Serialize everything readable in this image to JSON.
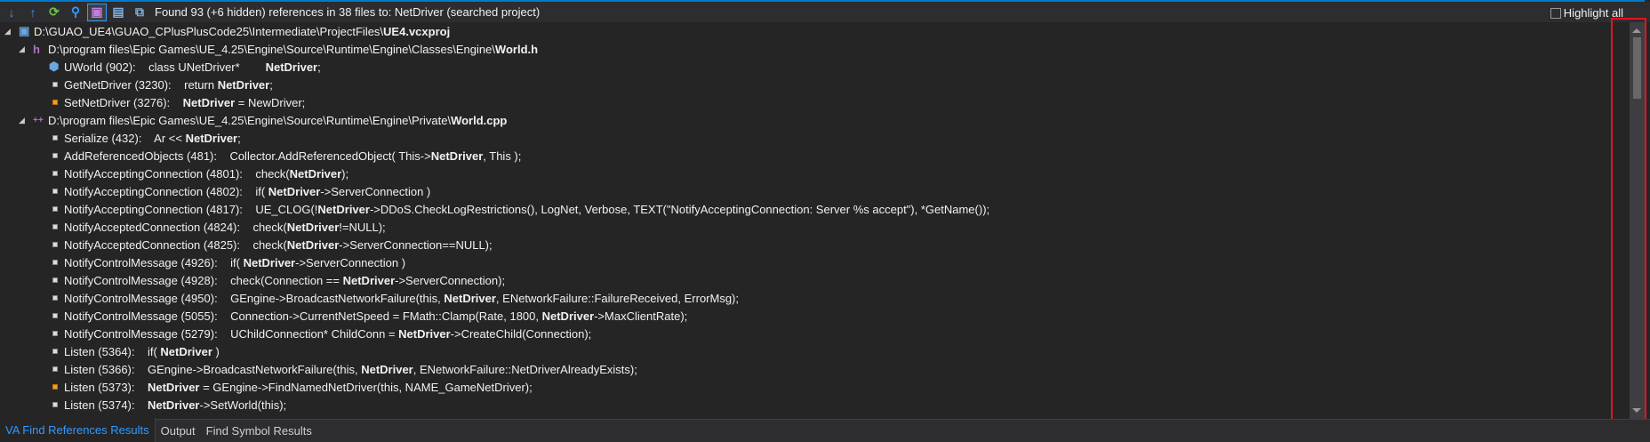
{
  "toolbar": {
    "buttons": [
      {
        "name": "next-result-icon",
        "glyph": "↓",
        "color": "#3399ff"
      },
      {
        "name": "previous-result-icon",
        "glyph": "↑",
        "color": "#3399ff"
      },
      {
        "name": "refresh-icon",
        "glyph": "⟳",
        "color": "#6cc24a"
      },
      {
        "name": "find-icon",
        "glyph": "⚲",
        "color": "#3399ff"
      },
      {
        "name": "group-by-project-icon",
        "glyph": "▣",
        "color": "#c080e0",
        "pressed": true
      },
      {
        "name": "group-by-file-icon",
        "glyph": "▤",
        "color": "#7fb0e0"
      },
      {
        "name": "show-context-icon",
        "glyph": "⧉",
        "color": "#7fb0e0"
      }
    ],
    "summary": "Found 93 (+6 hidden) references in 38 files to: NetDriver (searched project)",
    "highlight_all": "Highlight all"
  },
  "rows": [
    {
      "level": 0,
      "kind": "project",
      "segs": [
        {
          "t": "D:\\GUAO_UE4\\GUAO_CPlusPlusCode25\\Intermediate\\ProjectFiles\\"
        },
        {
          "t": "UE4.vcxproj",
          "b": true
        }
      ]
    },
    {
      "level": 1,
      "kind": "header",
      "segs": [
        {
          "t": "D:\\program files\\Epic Games\\UE_4.25\\Engine\\Source\\Runtime\\Engine\\Classes\\Engine\\"
        },
        {
          "t": "World.h",
          "b": true
        }
      ]
    },
    {
      "level": 2,
      "kind": "decl",
      "loc": "UWorld (902):",
      "segs": [
        {
          "t": "class UNetDriver*        "
        },
        {
          "t": "NetDriver",
          "b": true
        },
        {
          "t": ";"
        }
      ]
    },
    {
      "level": 2,
      "kind": "read",
      "loc": "GetNetDriver (3230):",
      "segs": [
        {
          "t": "return "
        },
        {
          "t": "NetDriver",
          "b": true
        },
        {
          "t": ";"
        }
      ]
    },
    {
      "level": 2,
      "kind": "write",
      "loc": "SetNetDriver (3276):",
      "segs": [
        {
          "t": "NetDriver",
          "b": true
        },
        {
          "t": " = NewDriver;"
        }
      ]
    },
    {
      "level": 1,
      "kind": "cpp",
      "segs": [
        {
          "t": "D:\\program files\\Epic Games\\UE_4.25\\Engine\\Source\\Runtime\\Engine\\Private\\"
        },
        {
          "t": "World.cpp",
          "b": true
        }
      ]
    },
    {
      "level": 2,
      "kind": "read",
      "loc": "Serialize (432):",
      "segs": [
        {
          "t": "Ar << "
        },
        {
          "t": "NetDriver",
          "b": true
        },
        {
          "t": ";"
        }
      ]
    },
    {
      "level": 2,
      "kind": "read",
      "loc": "AddReferencedObjects (481):",
      "segs": [
        {
          "t": "Collector.AddReferencedObject( This->"
        },
        {
          "t": "NetDriver",
          "b": true
        },
        {
          "t": ", This );"
        }
      ]
    },
    {
      "level": 2,
      "kind": "read",
      "loc": "NotifyAcceptingConnection (4801):",
      "segs": [
        {
          "t": "check("
        },
        {
          "t": "NetDriver",
          "b": true
        },
        {
          "t": ");"
        }
      ]
    },
    {
      "level": 2,
      "kind": "read",
      "loc": "NotifyAcceptingConnection (4802):",
      "segs": [
        {
          "t": "if( "
        },
        {
          "t": "NetDriver",
          "b": true
        },
        {
          "t": "->ServerConnection )"
        }
      ]
    },
    {
      "level": 2,
      "kind": "read",
      "loc": "NotifyAcceptingConnection (4817):",
      "segs": [
        {
          "t": "UE_CLOG(!"
        },
        {
          "t": "NetDriver",
          "b": true
        },
        {
          "t": "->DDoS.CheckLogRestrictions(), LogNet, Verbose, TEXT(\"NotifyAcceptingConnection: Server %s accept\"), *GetName());"
        }
      ]
    },
    {
      "level": 2,
      "kind": "read",
      "loc": "NotifyAcceptedConnection (4824):",
      "segs": [
        {
          "t": "check("
        },
        {
          "t": "NetDriver",
          "b": true
        },
        {
          "t": "!=NULL);"
        }
      ]
    },
    {
      "level": 2,
      "kind": "read",
      "loc": "NotifyAcceptedConnection (4825):",
      "segs": [
        {
          "t": "check("
        },
        {
          "t": "NetDriver",
          "b": true
        },
        {
          "t": "->ServerConnection==NULL);"
        }
      ]
    },
    {
      "level": 2,
      "kind": "read",
      "loc": "NotifyControlMessage (4926):",
      "segs": [
        {
          "t": "if( "
        },
        {
          "t": "NetDriver",
          "b": true
        },
        {
          "t": "->ServerConnection )"
        }
      ]
    },
    {
      "level": 2,
      "kind": "read",
      "loc": "NotifyControlMessage (4928):",
      "segs": [
        {
          "t": "check(Connection == "
        },
        {
          "t": "NetDriver",
          "b": true
        },
        {
          "t": "->ServerConnection);"
        }
      ]
    },
    {
      "level": 2,
      "kind": "read",
      "loc": "NotifyControlMessage (4950):",
      "segs": [
        {
          "t": "GEngine->BroadcastNetworkFailure(this, "
        },
        {
          "t": "NetDriver",
          "b": true
        },
        {
          "t": ", ENetworkFailure::FailureReceived, ErrorMsg);"
        }
      ]
    },
    {
      "level": 2,
      "kind": "read",
      "loc": "NotifyControlMessage (5055):",
      "segs": [
        {
          "t": "Connection->CurrentNetSpeed = FMath::Clamp(Rate, 1800, "
        },
        {
          "t": "NetDriver",
          "b": true
        },
        {
          "t": "->MaxClientRate);"
        }
      ]
    },
    {
      "level": 2,
      "kind": "read",
      "loc": "NotifyControlMessage (5279):",
      "segs": [
        {
          "t": "UChildConnection* ChildConn = "
        },
        {
          "t": "NetDriver",
          "b": true
        },
        {
          "t": "->CreateChild(Connection);"
        }
      ]
    },
    {
      "level": 2,
      "kind": "read",
      "loc": "Listen (5364):",
      "segs": [
        {
          "t": "if( "
        },
        {
          "t": "NetDriver",
          "b": true
        },
        {
          "t": " )"
        }
      ]
    },
    {
      "level": 2,
      "kind": "read",
      "loc": "Listen (5366):",
      "segs": [
        {
          "t": "GEngine->BroadcastNetworkFailure(this, "
        },
        {
          "t": "NetDriver",
          "b": true
        },
        {
          "t": ", ENetworkFailure::NetDriverAlreadyExists);"
        }
      ]
    },
    {
      "level": 2,
      "kind": "write",
      "loc": "Listen (5373):",
      "segs": [
        {
          "t": "NetDriver",
          "b": true
        },
        {
          "t": " = GEngine->FindNamedNetDriver(this, NAME_GameNetDriver);"
        }
      ]
    },
    {
      "level": 2,
      "kind": "read",
      "loc": "Listen (5374):",
      "segs": [
        {
          "t": "NetDriver",
          "b": true
        },
        {
          "t": "->SetWorld(this);"
        }
      ]
    }
  ],
  "tabs": [
    "VA Find References Results",
    "Output",
    "Find Symbol Results"
  ],
  "colors": {
    "accent": "#007acc",
    "active_tab": "#3399ff",
    "annotation": "#e81123"
  }
}
